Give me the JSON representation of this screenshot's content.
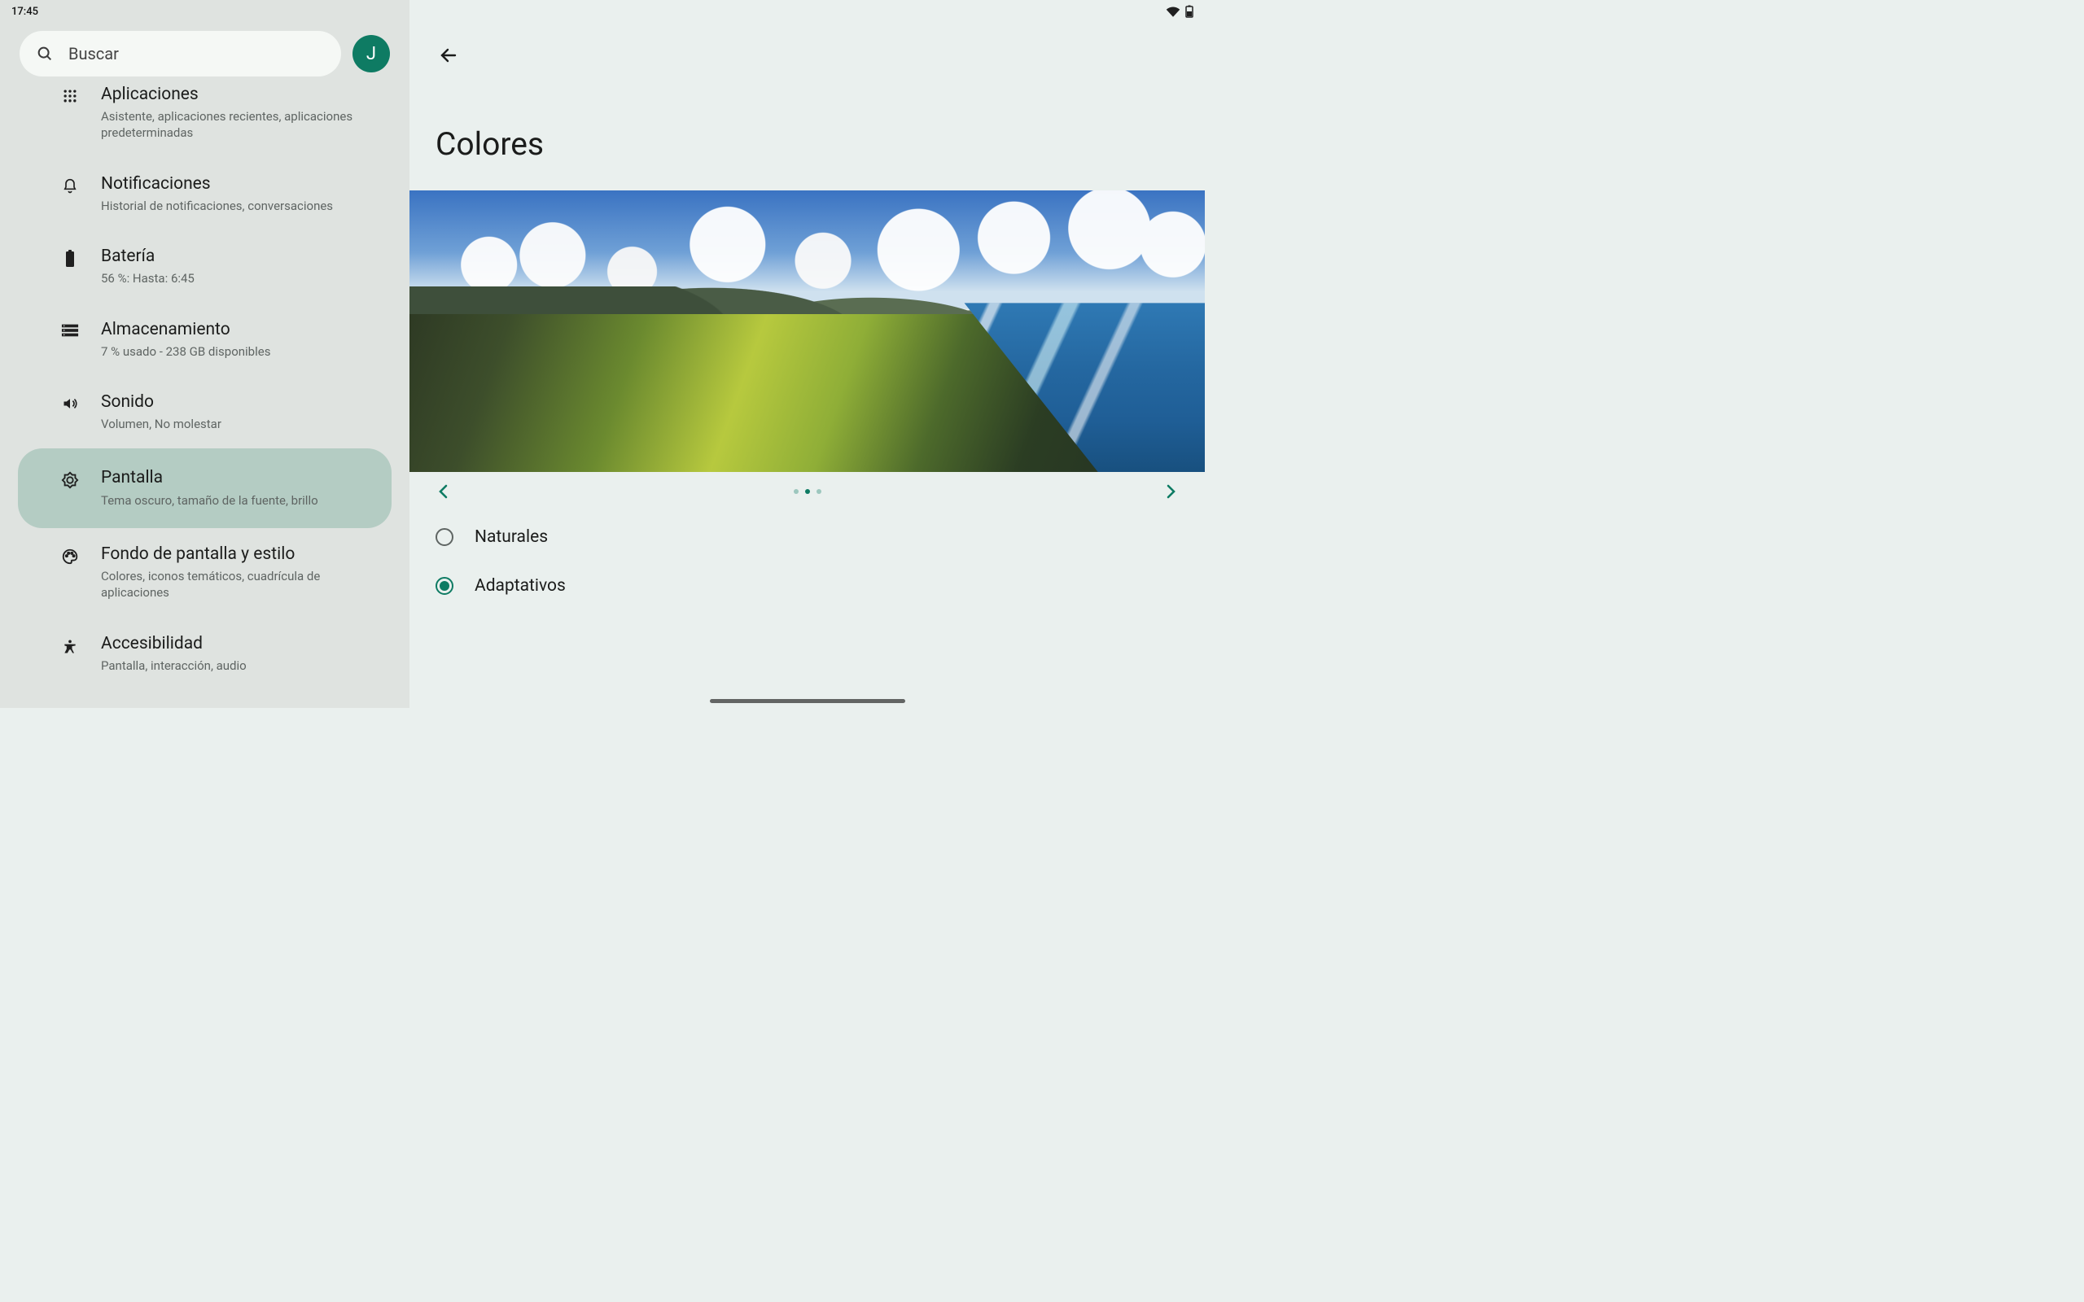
{
  "statusbar": {
    "time": "17:45"
  },
  "search": {
    "placeholder": "Buscar"
  },
  "avatar": {
    "initial": "J"
  },
  "sidebar": {
    "items": [
      {
        "title": "Aplicaciones",
        "sub": "Asistente, aplicaciones recientes, aplicaciones predeterminadas",
        "icon": "apps-icon",
        "selected": false,
        "clipped": true
      },
      {
        "title": "Notificaciones",
        "sub": "Historial de notificaciones, conversaciones",
        "icon": "bell-icon",
        "selected": false
      },
      {
        "title": "Batería",
        "sub": "56 %: Hasta: 6:45",
        "icon": "battery-icon",
        "selected": false
      },
      {
        "title": "Almacenamiento",
        "sub": "7 % usado - 238 GB disponibles",
        "icon": "storage-icon",
        "selected": false
      },
      {
        "title": "Sonido",
        "sub": "Volumen, No molestar",
        "icon": "sound-icon",
        "selected": false
      },
      {
        "title": "Pantalla",
        "sub": "Tema oscuro, tamaño de la fuente, brillo",
        "icon": "brightness-icon",
        "selected": true
      },
      {
        "title": "Fondo de pantalla y estilo",
        "sub": "Colores, iconos temáticos, cuadrícula de aplicaciones",
        "icon": "palette-icon",
        "selected": false
      },
      {
        "title": "Accesibilidad",
        "sub": "Pantalla, interacción, audio",
        "icon": "accessibility-icon",
        "selected": false
      }
    ]
  },
  "page": {
    "title": "Colores"
  },
  "pager": {
    "count": 3,
    "active": 1
  },
  "options": [
    {
      "label": "Naturales",
      "checked": false
    },
    {
      "label": "Adaptativos",
      "checked": true
    }
  ]
}
